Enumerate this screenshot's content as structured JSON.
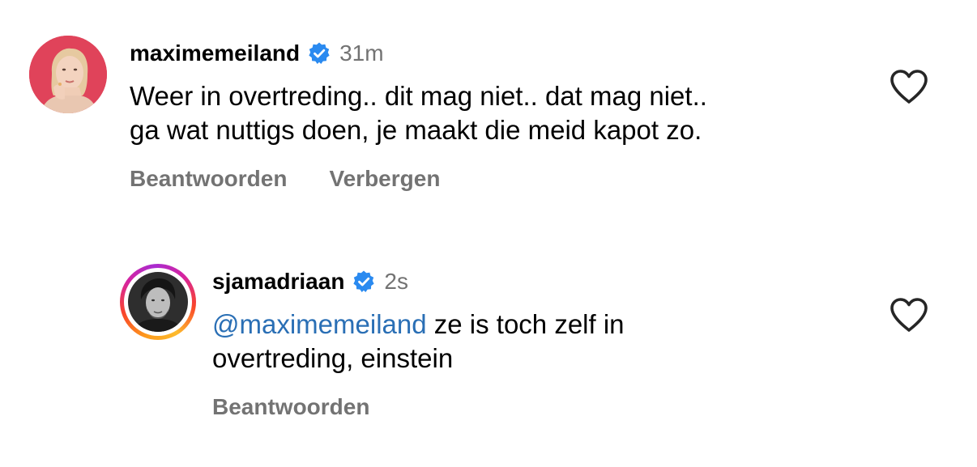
{
  "comments": [
    {
      "username": "maximemeiland",
      "verified": true,
      "timestamp": "31m",
      "text_line1": "Weer in overtreding.. dit mag niet.. dat mag niet..",
      "text_line2": "ga wat nuttigs doen, je maakt die meid kapot zo.",
      "actions": [
        "Beantwoorden",
        "Verbergen"
      ],
      "avatar_bg": "#e0435a"
    },
    {
      "username": "sjamadriaan",
      "verified": true,
      "timestamp": "2s",
      "mention": "@maximemeiland",
      "text_line1_rest": " ze is toch zelf in",
      "text_line2": "overtreding, einstein",
      "actions": [
        "Beantwoorden"
      ],
      "story_ring": true
    }
  ],
  "icons": {
    "verified": "verified-badge-icon",
    "like": "heart-outline-icon"
  },
  "colors": {
    "verified_blue": "#2a8af0",
    "secondary_text": "#737373",
    "mention": "#2a6fb5",
    "heart_stroke": "#262626"
  }
}
